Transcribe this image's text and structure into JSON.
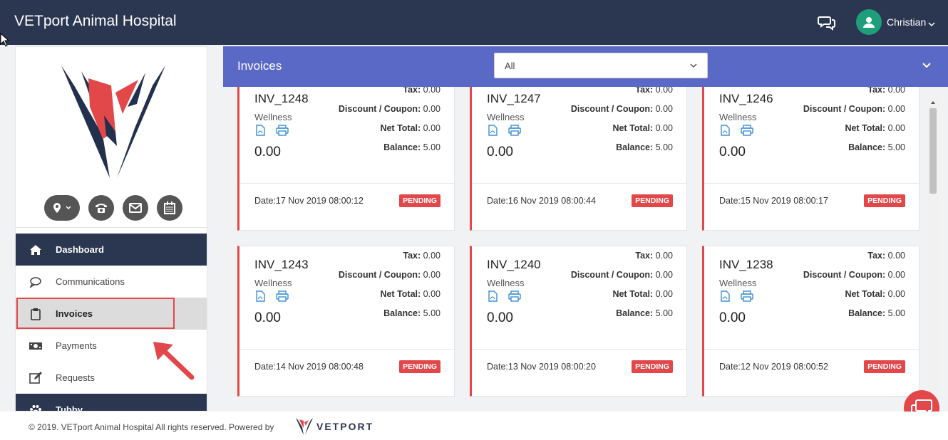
{
  "header": {
    "title": "VETport Animal Hospital",
    "user_name": "Christian"
  },
  "sidebar": {
    "nav": [
      {
        "label": "Dashboard",
        "icon": "home-icon"
      },
      {
        "label": "Communications",
        "icon": "speech-bubble-icon"
      },
      {
        "label": "Invoices",
        "icon": "clipboard-icon"
      },
      {
        "label": "Payments",
        "icon": "money-icon"
      },
      {
        "label": "Requests",
        "icon": "edit-icon"
      },
      {
        "label": "Tubby",
        "icon": "paw-icon"
      }
    ]
  },
  "main": {
    "title": "Invoices",
    "filter_value": "All"
  },
  "labels": {
    "tax": "Tax:",
    "discount": "Discount / Coupon:",
    "net_total": "Net Total:",
    "balance": "Balance:"
  },
  "invoices": [
    {
      "id": "INV_1248",
      "category": "Wellness",
      "amount": "0.00",
      "tax": "0.00",
      "discount": "0.00",
      "net_total": "0.00",
      "balance": "5.00",
      "date": "Date:17 Nov 2019 08:00:12",
      "status": "PENDING"
    },
    {
      "id": "INV_1247",
      "category": "Wellness",
      "amount": "0.00",
      "tax": "0.00",
      "discount": "0.00",
      "net_total": "0.00",
      "balance": "5.00",
      "date": "Date:16 Nov 2019 08:00:44",
      "status": "PENDING"
    },
    {
      "id": "INV_1246",
      "category": "Wellness",
      "amount": "0.00",
      "tax": "0.00",
      "discount": "0.00",
      "net_total": "0.00",
      "balance": "5.00",
      "date": "Date:15 Nov 2019 08:00:17",
      "status": "PENDING"
    },
    {
      "id": "INV_1243",
      "category": "Wellness",
      "amount": "0.00",
      "tax": "0.00",
      "discount": "0.00",
      "net_total": "0.00",
      "balance": "5.00",
      "date": "Date:14 Nov 2019 08:00:48",
      "status": "PENDING"
    },
    {
      "id": "INV_1240",
      "category": "Wellness",
      "amount": "0.00",
      "tax": "0.00",
      "discount": "0.00",
      "net_total": "0.00",
      "balance": "5.00",
      "date": "Date:13 Nov 2019 08:00:20",
      "status": "PENDING"
    },
    {
      "id": "INV_1238",
      "category": "Wellness",
      "amount": "0.00",
      "tax": "0.00",
      "discount": "0.00",
      "net_total": "0.00",
      "balance": "5.00",
      "date": "Date:12 Nov 2019 08:00:52",
      "status": "PENDING"
    }
  ],
  "footer": {
    "copyright_prefix": "© 2019.",
    "hospital_link": "VETport Animal Hospital",
    "suffix": "All rights reserved. Powered by",
    "brand": "VETPORT"
  },
  "colors": {
    "topbar": "#2b3650",
    "header_band": "#5b69c6",
    "accent_red": "#e2474a",
    "avatar": "#1f9e7c",
    "icon_blue": "#3b8fd4"
  }
}
